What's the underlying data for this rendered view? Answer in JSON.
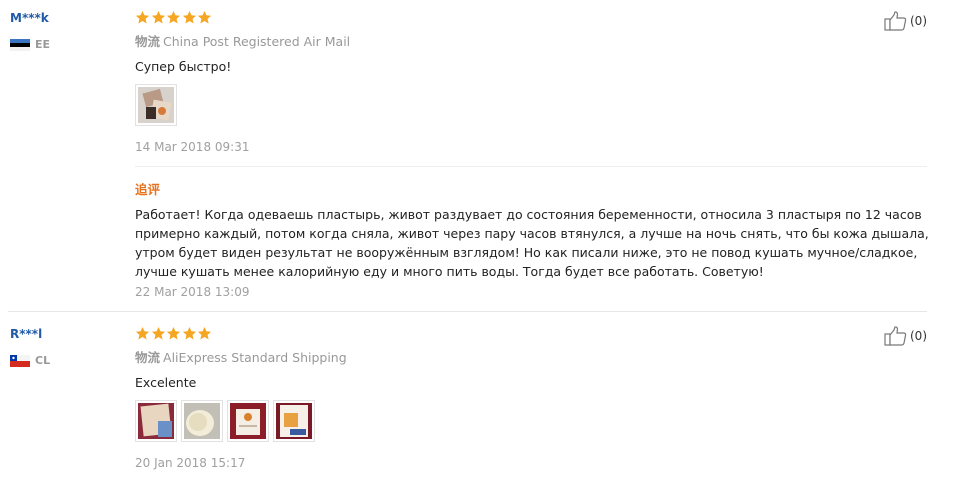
{
  "reviews": [
    {
      "user": "M***k",
      "country": "EE",
      "rating": 5,
      "shipping_tag": "物流",
      "shipping": "China Post Registered Air Mail",
      "comment": "Супер быстро!",
      "date": "14 Mar 2018 09:31",
      "likes": "(0)",
      "followup_label": "追评",
      "followup_text": "Работает! Когда одеваешь пластырь, живот раздувает до состояния беременности, относила 3 пластыря по 12 часов примерно каждый, потом когда сняла, живот через пару часов втянулся, а лучше на ночь снять, что бы кожа дышала, утром будет виден результат не вооружённым взглядом! Но как писали ниже, это не повод кушать мучное/сладкое, лучше кушать менее калорийную еду и много пить воды. Тогда будет все работать. Советую!",
      "followup_date": "22 Mar 2018 13:09"
    },
    {
      "user": "R***l",
      "country": "CL",
      "rating": 5,
      "shipping_tag": "物流",
      "shipping": "AliExpress Standard Shipping",
      "comment": "Excelente",
      "date": "20 Jan 2018 15:17",
      "likes": "(0)"
    }
  ],
  "colors": {
    "username": "#205aa7",
    "star": "#f5a623",
    "followup_label": "#e8721c",
    "meta_text": "#999999"
  },
  "icons": {
    "star": "star-icon",
    "like": "thumbs-up-icon"
  }
}
